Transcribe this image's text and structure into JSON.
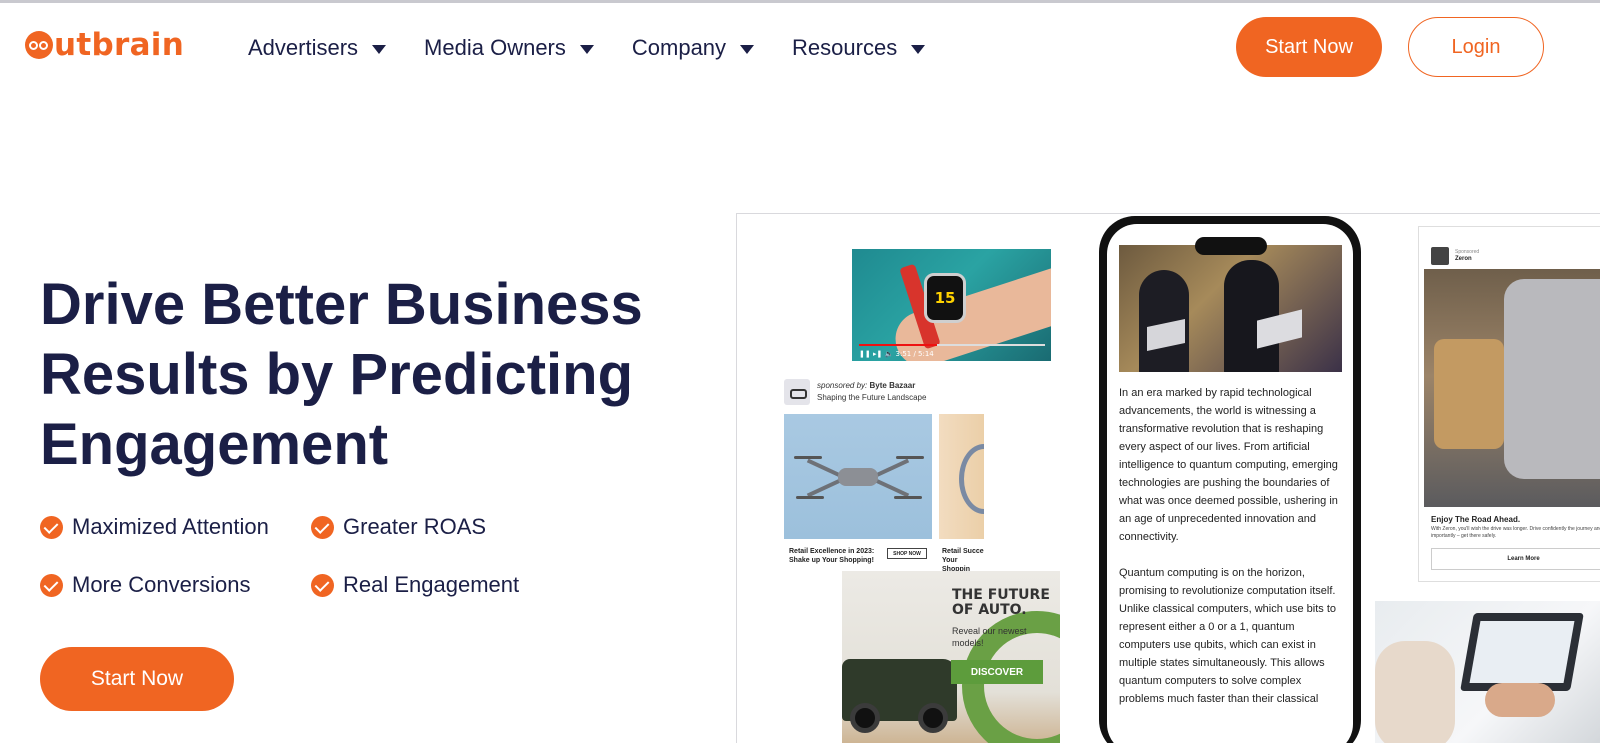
{
  "header": {
    "logo_text": "utbrain",
    "nav": [
      {
        "label": "Advertisers"
      },
      {
        "label": "Media Owners"
      },
      {
        "label": "Company"
      },
      {
        "label": "Resources"
      }
    ],
    "start_now": "Start Now",
    "login": "Login"
  },
  "hero": {
    "title": "Drive Better Business Results by Predicting Engagement",
    "features": [
      "Maximized Attention",
      "Greater ROAS",
      "More Conversions",
      "Real Engagement"
    ],
    "cta": "Start Now"
  },
  "showcase": {
    "video": {
      "watch_number": "15",
      "time": "3:51 / 5:14"
    },
    "ad_byte_bazaar": {
      "sponsored_by": "sponsored by:",
      "brand": "Byte Bazaar",
      "tagline": "Shaping the Future Landscape",
      "caption1": "Retail Excellence in 2023: Shake up Your Shopping!",
      "shop_button": "SHOP NOW",
      "caption2": "Retail Succe Your Shoppin"
    },
    "ad_auto": {
      "title": "THE FUTURE OF AUTO.",
      "subtitle": "Reveal our newest models!",
      "button": "DISCOVER"
    },
    "phone_article": [
      "In an era marked by rapid technological advancements, the world is witnessing a transformative revolution that is reshaping every aspect of our lives. From artificial intelligence to quantum computing, emerging technologies are pushing the boundaries of what was once deemed possible, ushering in an age of unprecedented innovation and connectivity.",
      "Quantum computing is on the horizon, promising to revolutionize computation itself. Unlike classical computers, which use bits to represent either a 0 or a 1, quantum computers use qubits, which can exist in multiple states simultaneously. This allows quantum computers to solve complex problems much faster than their classical"
    ],
    "ad_zeron": {
      "sponsored": "Sponsored",
      "brand": "Zeron",
      "title": "Enjoy The Road Ahead.",
      "desc": "With Zeron, you'll wish the drive was longer. Drive confidently the journey and most importantly – get there safely.",
      "button": "Learn More"
    }
  },
  "colors": {
    "brand_orange": "#f06522",
    "navy": "#1b1f46",
    "discover_green": "#5d9c3c"
  }
}
